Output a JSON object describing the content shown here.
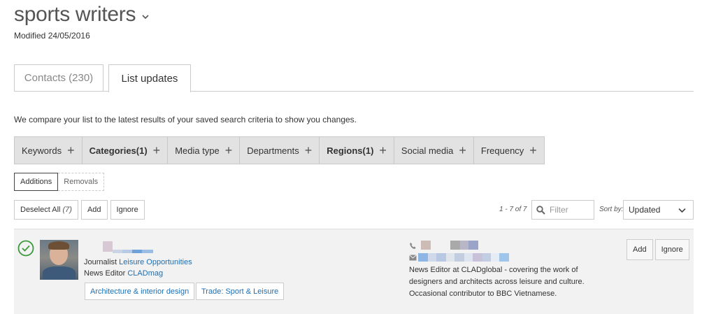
{
  "header": {
    "title": "sports writers",
    "modified": "Modified 24/05/2016"
  },
  "tabs": [
    {
      "label": "Contacts (230)",
      "active": false
    },
    {
      "label": "List updates",
      "active": true
    }
  ],
  "description": "We compare your list to the latest results of your saved search criteria to show you changes.",
  "filters": [
    {
      "label": "Keywords",
      "bold": false
    },
    {
      "label": "Categories(1)",
      "bold": true
    },
    {
      "label": "Media type",
      "bold": false
    },
    {
      "label": "Departments",
      "bold": false
    },
    {
      "label": "Regions(1)",
      "bold": true
    },
    {
      "label": "Social media",
      "bold": false
    },
    {
      "label": "Frequency",
      "bold": false
    }
  ],
  "filter_plus": "+",
  "segments": {
    "additions": "Additions",
    "removals": "Removals"
  },
  "actions": {
    "deselect_all": "Deselect All",
    "deselect_count": "(7)",
    "add": "Add",
    "ignore": "Ignore"
  },
  "pager": "1 - 7 of 7",
  "filter_input": {
    "placeholder": "Filter",
    "value": ""
  },
  "sort": {
    "label": "Sort by:",
    "value": "Updated"
  },
  "contact": {
    "role1_prefix": "Journalist",
    "role1_link": "Leisure Opportunities",
    "role2_prefix": "News Editor",
    "role2_link": "CLADmag",
    "tags": [
      "Architecture & interior design",
      "Trade: Sport & Leisure"
    ],
    "bio": "News Editor at CLADglobal - covering the work of designers and architects across leisure and culture. Occasional contributor to BBC Vietnamese.",
    "add": "Add",
    "ignore": "Ignore"
  },
  "colors": {
    "accent": "#1a6fb5",
    "check": "#3a9a3a",
    "filter_bar": "#e2e2e2",
    "row_bg": "#f2f2f2"
  }
}
